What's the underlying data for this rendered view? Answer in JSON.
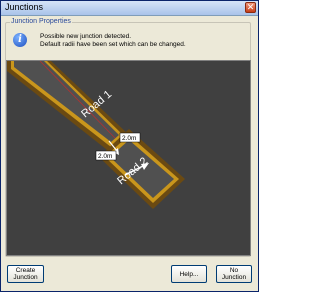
{
  "window": {
    "title": "Junctions",
    "close_glyph": "✕"
  },
  "group": {
    "label": "Junction Properties"
  },
  "info": {
    "icon": "info-icon",
    "line1": "Possible new junction detected.",
    "line2": "Default radii have been set which can be changed."
  },
  "preview": {
    "road1_label": "Road 1",
    "road2_label": "Road 2",
    "radius_label_1": "2.0m",
    "radius_label_2": "2.0m",
    "colors": {
      "background": "#404040",
      "road_outline": "#d4a017",
      "road_border": "#6b4a12",
      "road_surface": "#505050",
      "centerline_red": "#b33030"
    }
  },
  "buttons": {
    "create_line1": "Create",
    "create_line2": "Junction",
    "help": "Help...",
    "no_line1": "No",
    "no_line2": "Junction"
  }
}
